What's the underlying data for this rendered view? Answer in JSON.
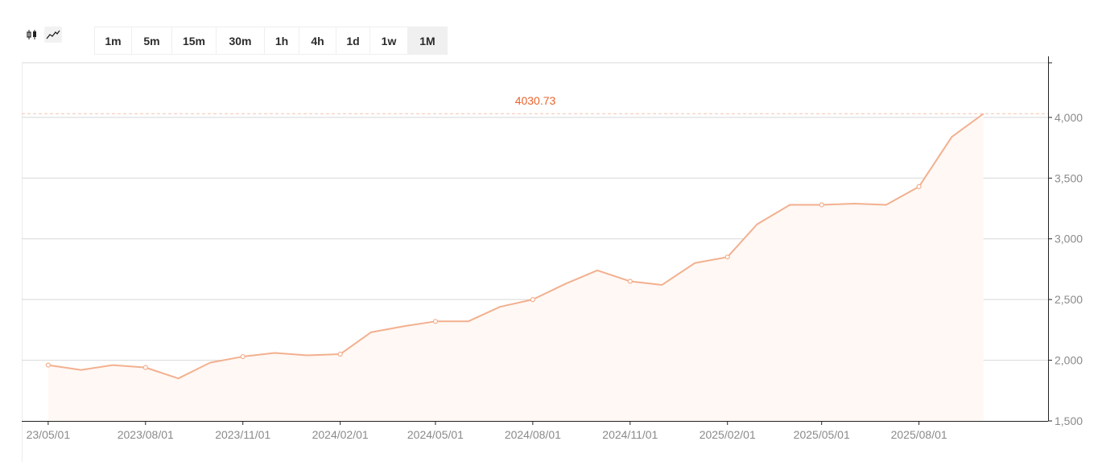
{
  "toolbar": {
    "chart_types": [
      {
        "name": "candlestick",
        "icon": "candlestick-icon",
        "active": false
      },
      {
        "name": "line",
        "icon": "line-chart-icon",
        "active": true
      }
    ],
    "intervals": [
      {
        "label": "1m",
        "width": 46
      },
      {
        "label": "5m",
        "width": 50
      },
      {
        "label": "15m",
        "width": 55
      },
      {
        "label": "30m",
        "width": 60
      },
      {
        "label": "1h",
        "width": 43
      },
      {
        "label": "4h",
        "width": 46
      },
      {
        "label": "1d",
        "width": 42
      },
      {
        "label": "1w",
        "width": 47
      },
      {
        "label": "1M",
        "width": 48
      }
    ],
    "active_interval": "1M"
  },
  "colors": {
    "line": "#f2b08f",
    "area": "#fff8f4",
    "price_label": "#e8632d",
    "price_dash": "#f2c4ae",
    "grid": "#d8d8d8",
    "axis_text": "#8a8a8a"
  },
  "chart_data": {
    "type": "area",
    "current_price_label": "4030.73",
    "current_price": 4030.73,
    "ylim": [
      1500,
      4450
    ],
    "yticks": [
      1500,
      2000,
      2500,
      3000,
      3500,
      4000
    ],
    "ytick_labels": [
      "1,500",
      "2,000",
      "2,500",
      "3,000",
      "3,500",
      "4,000"
    ],
    "xlim": [
      "2023-04-06",
      "2025-12-01"
    ],
    "xticks": [
      "2023-05-01",
      "2023-08-01",
      "2023-11-01",
      "2024-02-01",
      "2024-05-01",
      "2024-08-01",
      "2024-11-01",
      "2025-02-01",
      "2025-05-01",
      "2025-08-01"
    ],
    "xtick_labels": [
      "23/05/01",
      "2023/08/01",
      "2023/11/01",
      "2024/02/01",
      "2024/05/01",
      "2024/08/01",
      "2024/11/01",
      "2025/02/01",
      "2025/05/01",
      "2025/08/01"
    ],
    "x": [
      "2023-05-01",
      "2023-06-01",
      "2023-07-01",
      "2023-08-01",
      "2023-09-01",
      "2023-10-01",
      "2023-11-01",
      "2023-12-01",
      "2024-01-01",
      "2024-02-01",
      "2024-03-01",
      "2024-04-01",
      "2024-05-01",
      "2024-06-01",
      "2024-07-01",
      "2024-08-01",
      "2024-09-01",
      "2024-10-01",
      "2024-11-01",
      "2024-12-01",
      "2025-01-01",
      "2025-02-01",
      "2025-03-01",
      "2025-04-01",
      "2025-05-01",
      "2025-06-01",
      "2025-07-01",
      "2025-08-01",
      "2025-09-01",
      "2025-10-01"
    ],
    "series": [
      {
        "values": [
          1960,
          1920,
          1960,
          1940,
          1850,
          1980,
          2030,
          2060,
          2040,
          2050,
          2230,
          2280,
          2320,
          2320,
          2440,
          2500,
          2630,
          2740,
          2650,
          2620,
          2800,
          2850,
          3120,
          3280,
          3280,
          3290,
          3280,
          3430,
          3840,
          4030.73
        ],
        "markers": [
          0,
          3,
          6,
          9,
          12,
          15,
          18,
          21,
          24,
          27
        ]
      }
    ]
  }
}
